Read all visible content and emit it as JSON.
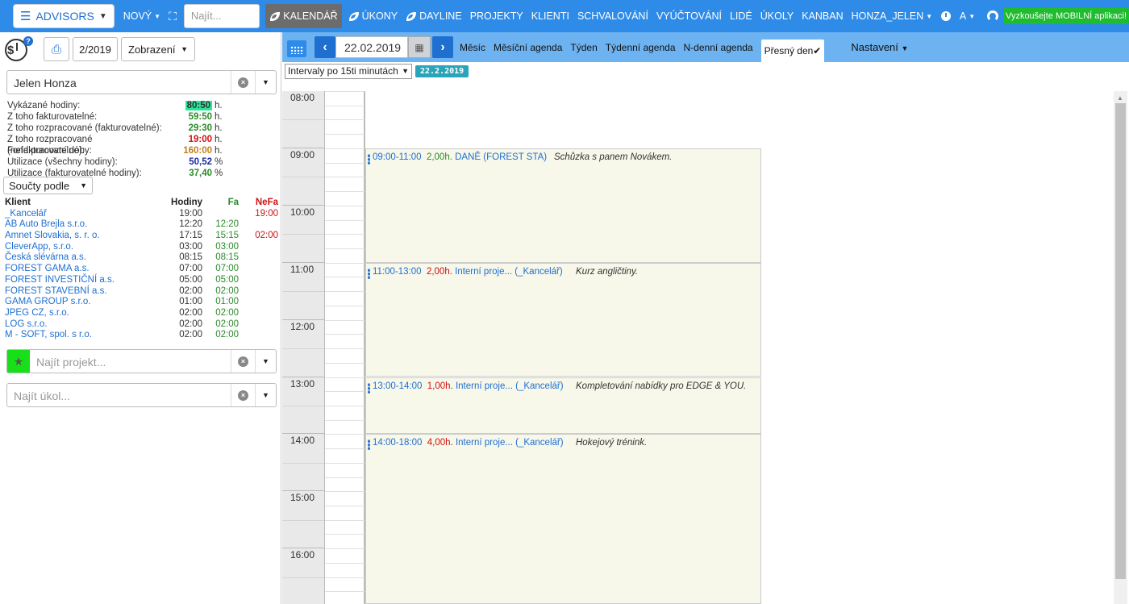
{
  "topnav": {
    "brand": "ADVISORS",
    "new_label": "NOVÝ",
    "search_placeholder": "Najít...",
    "items": [
      "KALENDÁŘ",
      "ÚKONY",
      "DAYLINE",
      "PROJEKTY",
      "KLIENTI",
      "SCHVALOVÁNÍ",
      "VYÚČTOVÁNÍ",
      "LIDÉ",
      "ÚKOLY",
      "KANBAN"
    ],
    "user": "HONZA_JELEN",
    "lang": "A",
    "mobile_label": "Vyzkoušejte MOBILNÍ aplikaci!"
  },
  "left": {
    "period": "2/2019",
    "view_label": "Zobrazení",
    "person": "Jelen Honza",
    "stats": [
      {
        "label": "Vykázané hodiny:",
        "value": "80:50",
        "unit": "h."
      },
      {
        "label": "Z toho fakturovatelné:",
        "value": "59:50",
        "unit": "h."
      },
      {
        "label": "Z toho rozpracované (fakturovatelné):",
        "value": "29:30",
        "unit": "h."
      },
      {
        "label": "Z toho rozpracované (nefakturovatelné):",
        "value": "19:00",
        "unit": "h."
      },
      {
        "label": "Fond pracovní doby:",
        "value": "160:00",
        "unit": "h."
      },
      {
        "label": "Utilizace (všechny hodiny):",
        "value": "50,52",
        "unit": "%"
      },
      {
        "label": "Utilizace (fakturovatelné hodiny):",
        "value": "37,40",
        "unit": "%"
      }
    ],
    "soucty_label": "Součty podle",
    "table_headers": [
      "Klient",
      "Hodiny",
      "Fa",
      "NeFa"
    ],
    "clients": [
      [
        "_Kancelář",
        "19:00",
        "",
        "19:00"
      ],
      [
        "AB Auto Brejla s.r.o.",
        "12:20",
        "12:20",
        ""
      ],
      [
        "Amnet Slovakia, s. r. o.",
        "17:15",
        "15:15",
        "02:00"
      ],
      [
        "CleverApp, s.r.o.",
        "03:00",
        "03:00",
        ""
      ],
      [
        "Česká slévárna a.s.",
        "08:15",
        "08:15",
        ""
      ],
      [
        "FOREST GAMA a.s.",
        "07:00",
        "07:00",
        ""
      ],
      [
        "FOREST INVESTIČNÍ a.s.",
        "05:00",
        "05:00",
        ""
      ],
      [
        "FOREST STAVEBNÍ a.s.",
        "02:00",
        "02:00",
        ""
      ],
      [
        "GAMA GROUP s.r.o.",
        "01:00",
        "01:00",
        ""
      ],
      [
        "JPEG CZ, s.r.o.",
        "02:00",
        "02:00",
        ""
      ],
      [
        "LOG s.r.o.",
        "02:00",
        "02:00",
        ""
      ],
      [
        "M - SOFT, spol. s r.o.",
        "02:00",
        "02:00",
        ""
      ]
    ],
    "project_placeholder": "Najít projekt...",
    "task_placeholder": "Najít úkol..."
  },
  "calendar": {
    "date": "22.02.2019",
    "views": [
      "Měsíc",
      "Měsíční agenda",
      "Týden",
      "Týdenní agenda",
      "N-denní agenda",
      "Přesný den"
    ],
    "active_view_check": "✔",
    "settings_label": "Nastavení",
    "interval_label": "Intervaly po 15ti minutách",
    "date_badge": "22.2.2019",
    "hours": [
      "08:00",
      "09:00",
      "10:00",
      "11:00",
      "12:00",
      "13:00",
      "14:00",
      "15:00",
      "16:00"
    ],
    "events": [
      {
        "time": "09:00-11:00",
        "hours": "2,00h.",
        "project": "DANĚ (FOREST STA)",
        "desc": "Schůzka s panem Novákem."
      },
      {
        "time": "11:00-13:00",
        "hours": "2,00h.",
        "project": "Interní proje... (_Kancelář)",
        "desc": "Kurz angličtiny."
      },
      {
        "time": "13:00-14:00",
        "hours": "1,00h.",
        "project": "Interní proje... (_Kancelář)",
        "desc": "Kompletování nabídky pro EDGE & YOU."
      },
      {
        "time": "14:00-18:00",
        "hours": "4,00h.",
        "project": "Interní proje... (_Kancelář)",
        "desc": "Hokejový trénink."
      }
    ]
  }
}
